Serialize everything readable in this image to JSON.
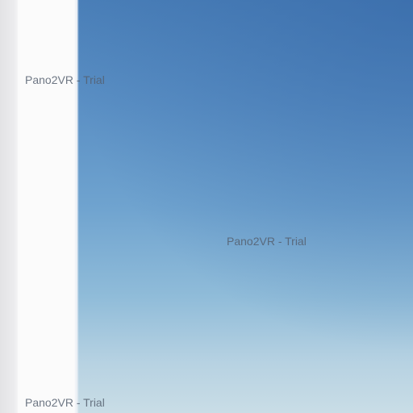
{
  "scene": {
    "description_tags": [
      "sky-gradient",
      "white-wall"
    ],
    "colors": {
      "sky_top": "#4a7fb8",
      "sky_bottom": "#c9dde6",
      "wall": "#fbfbfb",
      "wall_shadow": "#e3e3e5"
    }
  },
  "watermarks": [
    {
      "text": "Pano2VR - Trial"
    },
    {
      "text": "Pano2VR - Trial"
    },
    {
      "text": "Pano2VR - Trial"
    }
  ]
}
